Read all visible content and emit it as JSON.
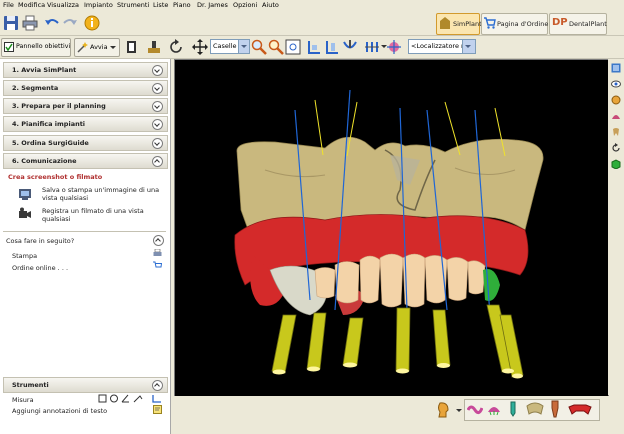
{
  "menu": [
    "File",
    "Modifica",
    "Visualizza",
    "Impianto",
    "Strumenti",
    "Liste",
    "Piano",
    "Dr. James",
    "Opzioni",
    "Aiuto"
  ],
  "product_tabs": {
    "simplant": "SimPlant",
    "pagina": "Pagina d'Ordine",
    "dental": "DentalPlant",
    "dp_logo": "DP"
  },
  "toolbar2": {
    "pannello": "Pannello obiettivi",
    "avvia": "Avvia",
    "caselle": "Caselle",
    "localizzatore": "<Localizzatore rapi"
  },
  "steps": [
    {
      "label": "1. Avvia SimPlant"
    },
    {
      "label": "2. Segmenta"
    },
    {
      "label": "3. Prepara per il planning"
    },
    {
      "label": "4. Pianifica impianti"
    },
    {
      "label": "5. Ordina SurgiGuide"
    },
    {
      "label": "6. Comunicazione"
    }
  ],
  "comunicazione": {
    "title": "Crea screenshot o filmato",
    "item1": "Salva o stampa un'immagine di una vista qualsiasi",
    "item2": "Registra un filmato di una vista qualsiasi"
  },
  "next": {
    "title": "Cosa fare in seguito?",
    "stampa": "Stampa",
    "ordine": "Ordine online . . ."
  },
  "strumenti": {
    "title": "Strumenti",
    "misura": "Misura",
    "annotazioni": "Aggiungi annotazioni di testo"
  },
  "colors": {
    "bone": "#c9b87e",
    "gum": "#d42a2a",
    "implant": "#c8c81c",
    "viewport_bg": "#000000",
    "accent": "#b03030"
  }
}
